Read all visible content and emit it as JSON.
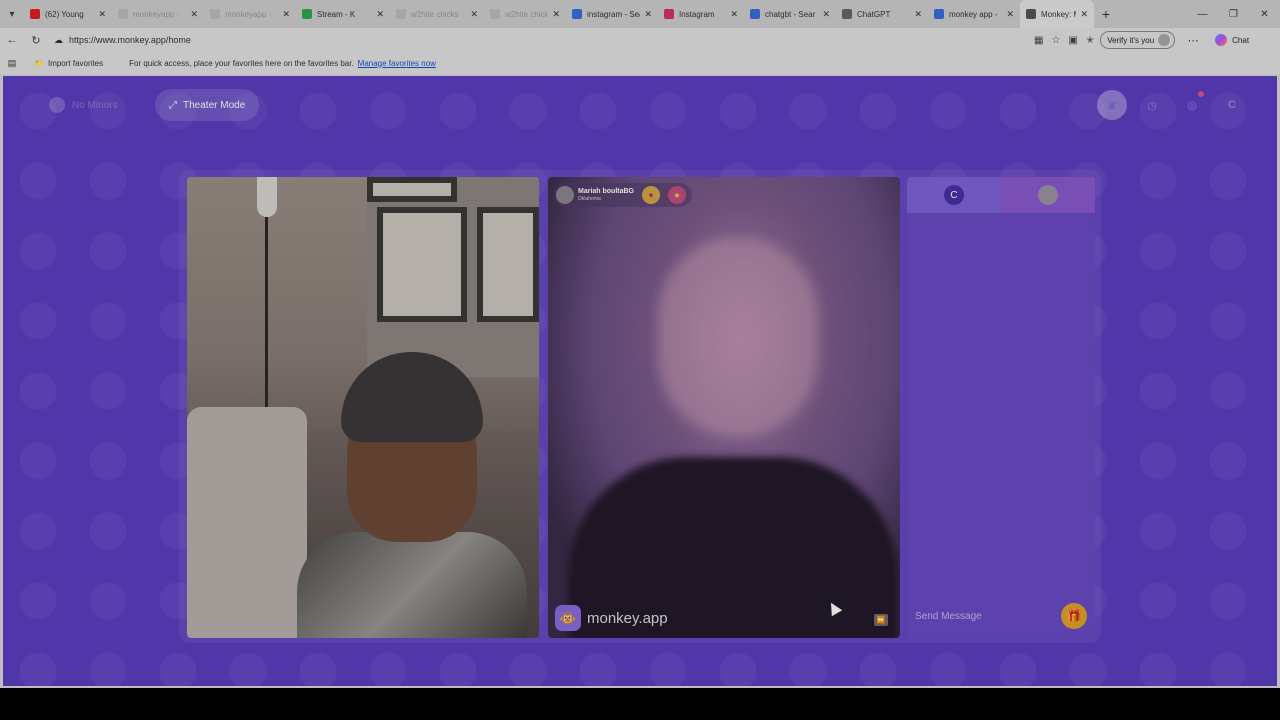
{
  "browser": {
    "tabs": [
      {
        "title": "(62) Young",
        "favicon_color": "#e02020",
        "dim": false,
        "active": false
      },
      {
        "title": "monkeyapp -",
        "favicon_color": "#bdbdbd",
        "dim": true,
        "active": false
      },
      {
        "title": "monkeyapp -",
        "favicon_color": "#bdbdbd",
        "dim": true,
        "active": false
      },
      {
        "title": "Stream - K",
        "favicon_color": "#2fa84f",
        "dim": false,
        "active": false
      },
      {
        "title": "w2hite chicks",
        "favicon_color": "#bdbdbd",
        "dim": true,
        "active": false
      },
      {
        "title": "w2hite chicks",
        "favicon_color": "#bdbdbd",
        "dim": true,
        "active": false
      },
      {
        "title": "instagram - Sea",
        "favicon_color": "#3a6fe0",
        "dim": false,
        "active": false
      },
      {
        "title": "Instagram",
        "favicon_color": "#d6306b",
        "dim": false,
        "active": false
      },
      {
        "title": "chatgbt - Sear",
        "favicon_color": "#3a6fe0",
        "dim": false,
        "active": false
      },
      {
        "title": "ChatGPT",
        "favicon_color": "#666666",
        "dim": false,
        "active": false
      },
      {
        "title": "monkey app -",
        "favicon_color": "#3a6fe0",
        "dim": false,
        "active": false
      },
      {
        "title": "Monkey: M",
        "favicon_color": "#555555",
        "dim": false,
        "active": true
      }
    ],
    "url": "https://www.monkey.app/home",
    "verify_label": "Verify it's you",
    "chat_label": "Chat",
    "favorites": {
      "import_label": "Import favorites",
      "hint": "For quick access, place your favorites here on the favorites bar.",
      "manage_link": "Manage favorites now"
    }
  },
  "page": {
    "no_minors_label": "No Minors",
    "theater_label": "Theater Mode",
    "profile_initial": "C",
    "remote_user": {
      "name": "Mariah boultaBG",
      "location": "Oklahoma"
    },
    "watermark": "monkey.app",
    "chat": {
      "self_initial": "C",
      "placeholder": "Send Message"
    }
  },
  "colors": {
    "page_bg": "#5d3ec2",
    "accent": "#7d63d6",
    "gift": "#e0a42a"
  }
}
